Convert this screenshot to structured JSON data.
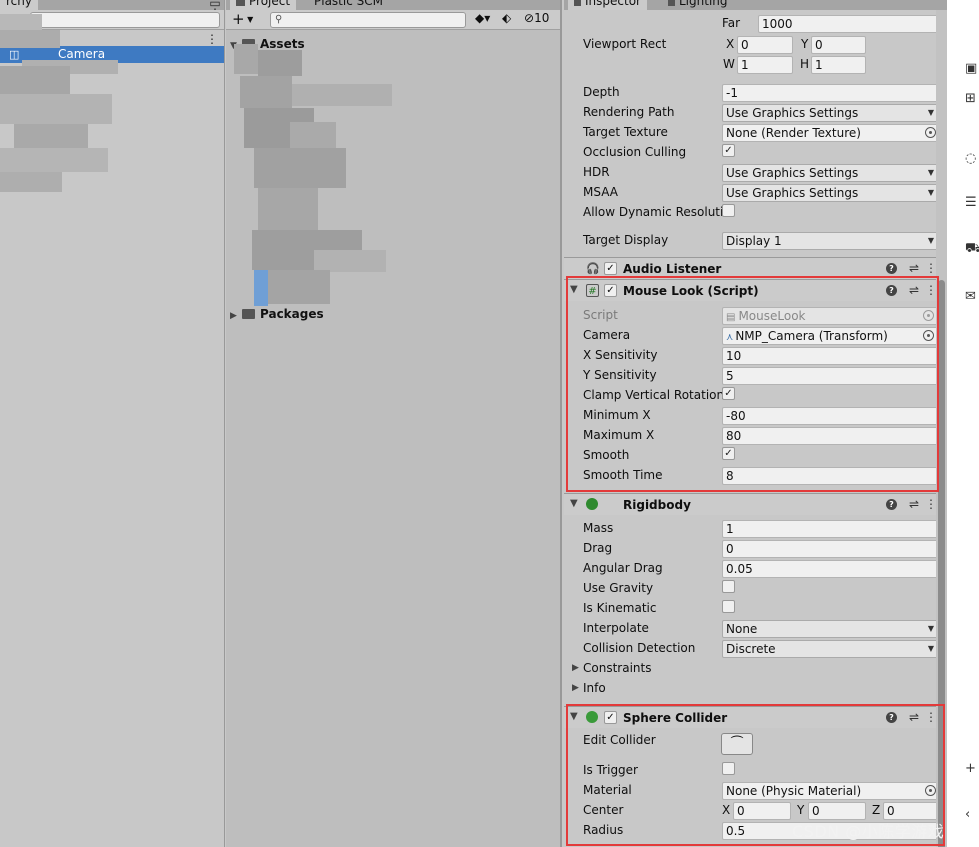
{
  "hierarchy": {
    "tab_label": "rchy",
    "selected_item": "Camera"
  },
  "project": {
    "tab_project": "Project",
    "tab_scm": "Plastic SCM",
    "add_label": "+",
    "hidden_count": "10",
    "folders": [
      "Assets",
      "Packages"
    ]
  },
  "inspector": {
    "tabs": [
      "Inspector",
      "Lighting"
    ],
    "camera": {
      "far_label": "Far",
      "far_value": "1000",
      "viewport_label": "Viewport Rect",
      "vx": "0",
      "vy": "0",
      "vw": "1",
      "vh": "1",
      "axis_x": "X",
      "axis_y": "Y",
      "axis_w": "W",
      "axis_h": "H",
      "depth_label": "Depth",
      "depth_value": "-1",
      "rendering_label": "Rendering Path",
      "rendering_value": "Use Graphics Settings",
      "target_texture_label": "Target Texture",
      "target_texture_value": "None (Render Texture)",
      "occlusion_label": "Occlusion Culling",
      "hdr_label": "HDR",
      "hdr_value": "Use Graphics Settings",
      "msaa_label": "MSAA",
      "msaa_value": "Use Graphics Settings",
      "dyn_res_label": "Allow Dynamic Resolutic",
      "target_display_label": "Target Display",
      "target_display_value": "Display 1"
    },
    "audio_listener": {
      "title": "Audio Listener"
    },
    "mouse_look": {
      "title": "Mouse Look (Script)",
      "script_label": "Script",
      "script_value": "MouseLook",
      "camera_label": "Camera",
      "camera_value": "NMP_Camera (Transform)",
      "xsens_label": "X Sensitivity",
      "xsens_value": "10",
      "ysens_label": "Y Sensitivity",
      "ysens_value": "5",
      "clamp_label": "Clamp Vertical Rotation",
      "min_label": "Minimum X",
      "min_value": "-80",
      "max_label": "Maximum X",
      "max_value": "80",
      "smooth_label": "Smooth",
      "smooth_time_label": "Smooth Time",
      "smooth_time_value": "8"
    },
    "rigidbody": {
      "title": "Rigidbody",
      "mass_label": "Mass",
      "mass_value": "1",
      "drag_label": "Drag",
      "drag_value": "0",
      "angular_label": "Angular Drag",
      "angular_value": "0.05",
      "gravity_label": "Use Gravity",
      "kinematic_label": "Is Kinematic",
      "interpolate_label": "Interpolate",
      "interpolate_value": "None",
      "collision_label": "Collision Detection",
      "collision_value": "Discrete",
      "constraints_label": "Constraints",
      "info_label": "Info"
    },
    "sphere_collider": {
      "title": "Sphere Collider",
      "edit_label": "Edit Collider",
      "trigger_label": "Is Trigger",
      "material_label": "Material",
      "material_value": "None (Physic Material)",
      "center_label": "Center",
      "cx": "0",
      "cy": "0",
      "cz": "0",
      "axis_z": "Z",
      "radius_label": "Radius",
      "radius_value": "0.5"
    }
  },
  "watermark": "CSDN @小陈学游戏",
  "colors": {
    "selection": "#3e7ac2",
    "highlight": "#e33a3a",
    "panel_bg": "#c8c8c8"
  }
}
